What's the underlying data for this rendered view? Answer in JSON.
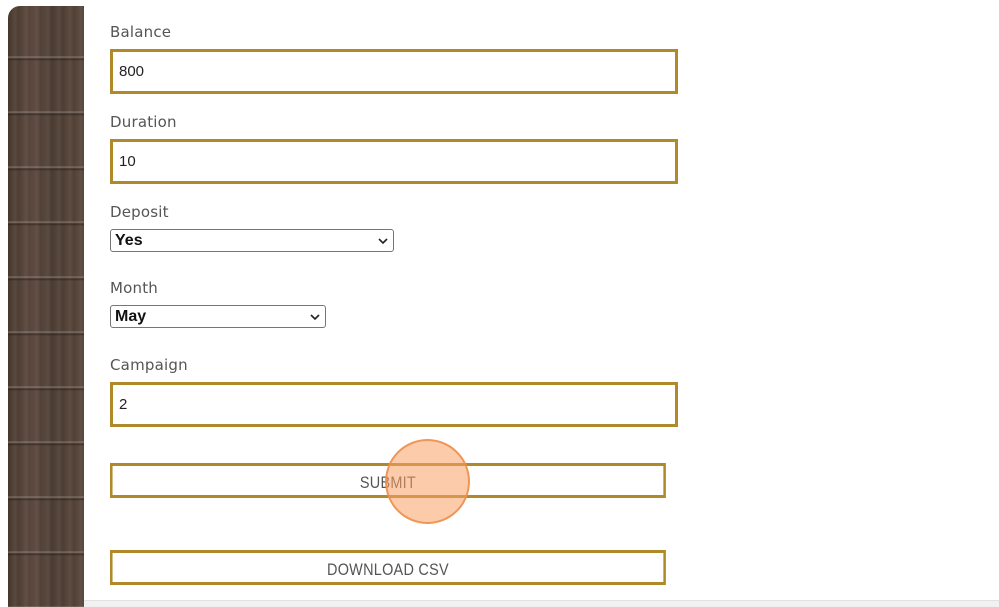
{
  "form": {
    "balance": {
      "label": "Balance",
      "value": "800"
    },
    "duration": {
      "label": "Duration",
      "value": "10"
    },
    "deposit": {
      "label": "Deposit",
      "selected": "Yes"
    },
    "month": {
      "label": "Month",
      "selected": "May"
    },
    "campaign": {
      "label": "Campaign",
      "value": "2"
    },
    "submit_label": "SUBMIT",
    "download_label": "DOWNLOAD CSV"
  },
  "icons": {
    "select_arrow": "chevron-down-icon"
  },
  "colors": {
    "input_border": "#b08a2a",
    "label_text": "#555555",
    "click_highlight": "#f8a064"
  }
}
